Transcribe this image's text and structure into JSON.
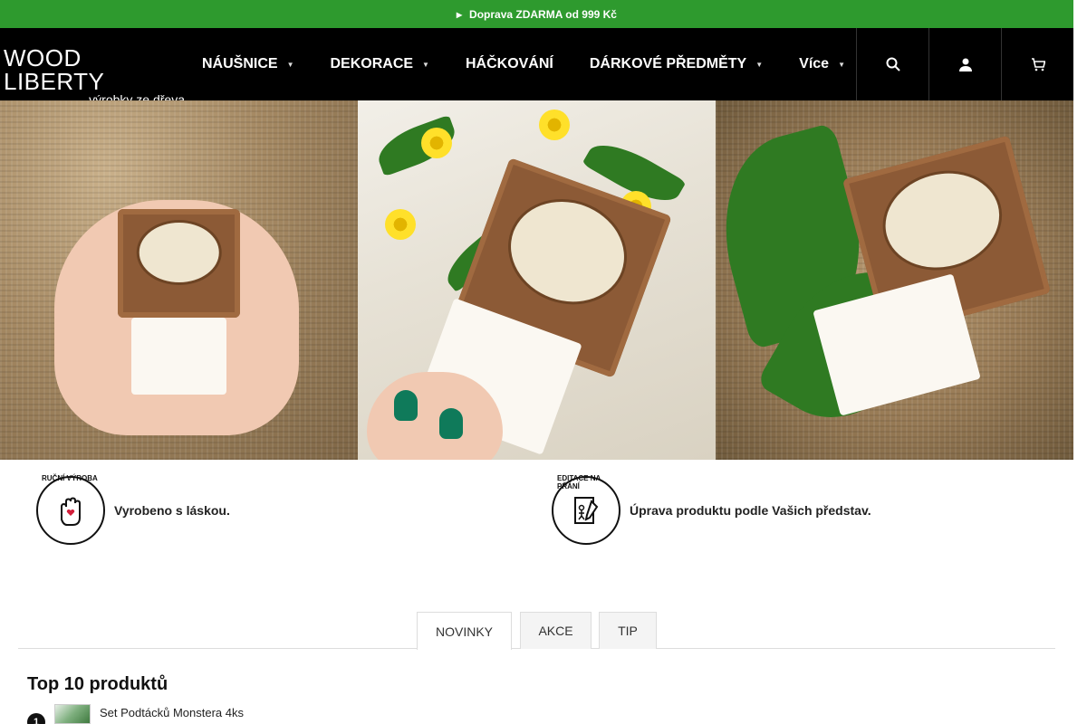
{
  "topbar": {
    "icon": "truck-icon",
    "text": "Doprava ZDARMA od 999 Kč"
  },
  "logo": {
    "main": "WOOD LIBERTY",
    "sub": "výrobky ze dřeva"
  },
  "nav": {
    "items": [
      {
        "label": "NÁUŠNICE",
        "has_dropdown": true
      },
      {
        "label": "DEKORACE",
        "has_dropdown": true
      },
      {
        "label": "HÁČKOVÁNÍ",
        "has_dropdown": false
      },
      {
        "label": "DÁRKOVÉ PŘEDMĚTY",
        "has_dropdown": true
      },
      {
        "label": "Více",
        "has_dropdown": true
      }
    ]
  },
  "header_icons": [
    "search-icon",
    "user-icon",
    "cart-icon"
  ],
  "features": [
    {
      "badge": "RUČNÍ VÝROBA",
      "icon": "hand-heart-icon",
      "text": "Vyrobeno s láskou."
    },
    {
      "badge": "EDITACE NA PŘÁNÍ",
      "icon": "edit-document-icon",
      "text": "Úprava produktu podle Vašich představ."
    }
  ],
  "tabs": [
    {
      "label": "NOVINKY",
      "active": true
    },
    {
      "label": "AKCE",
      "active": false
    },
    {
      "label": "TIP",
      "active": false
    }
  ],
  "top10": {
    "title": "Top 10 produktů",
    "items": [
      {
        "rank": "1",
        "name": "Set Podtácků Monstera 4ks"
      }
    ]
  },
  "colors": {
    "topbar": "#2e9a2e",
    "header": "#000000",
    "accent": "#ffffff"
  }
}
